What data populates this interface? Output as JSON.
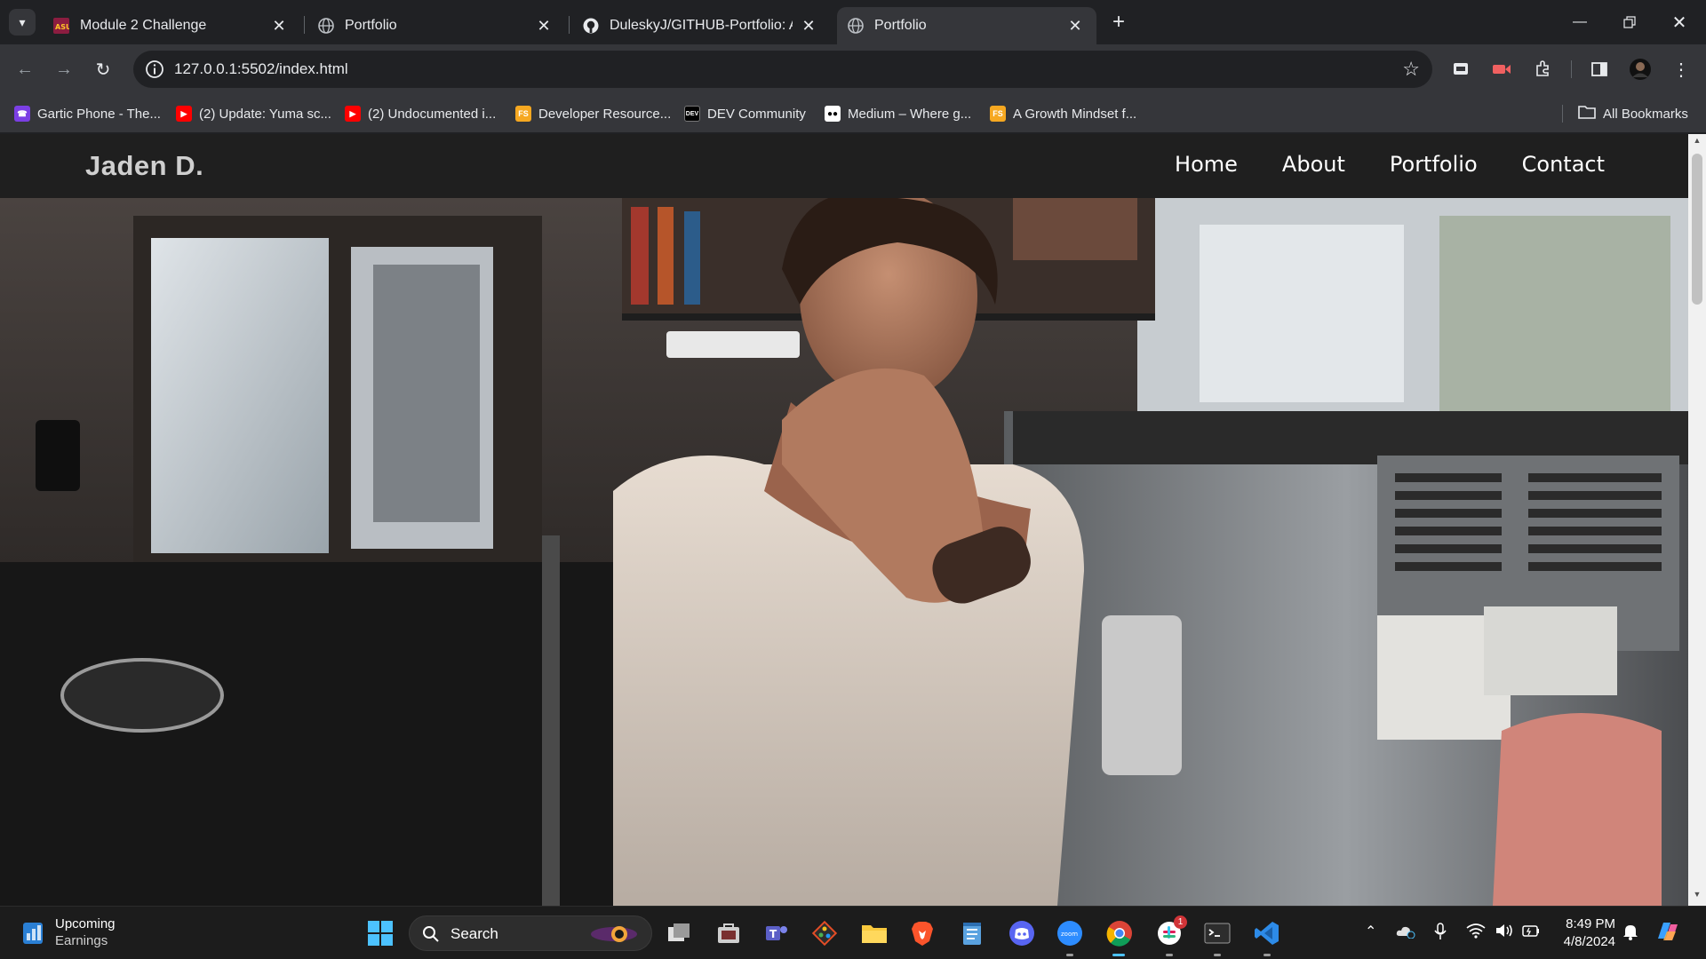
{
  "tabs": [
    {
      "title": "Module 2 Challenge",
      "favicon": "asu-icon",
      "active": false
    },
    {
      "title": "Portfolio",
      "favicon": "globe-icon",
      "active": false
    },
    {
      "title": "DuleskyJ/GITHUB-Portfolio: A w",
      "favicon": "github-icon",
      "active": false
    },
    {
      "title": "Portfolio",
      "favicon": "globe-icon",
      "active": true
    }
  ],
  "address_bar": {
    "url": "127.0.0.1:5502/index.html"
  },
  "bookmarks": [
    {
      "label": "Gartic Phone - The...",
      "icon": "gartic-icon",
      "color": "#7b3fe4"
    },
    {
      "label": "(2) Update: Yuma sc...",
      "icon": "youtube-icon",
      "color": "#ff0000"
    },
    {
      "label": "(2) Undocumented i...",
      "icon": "youtube-icon",
      "color": "#ff0000"
    },
    {
      "label": "Developer Resource...",
      "icon": "fs-icon",
      "color": "#f6a821"
    },
    {
      "label": "DEV Community",
      "icon": "dev-icon",
      "color": "#000000"
    },
    {
      "label": "Medium – Where g...",
      "icon": "medium-icon",
      "color": "#000000"
    },
    {
      "label": "A Growth Mindset f...",
      "icon": "fs-icon",
      "color": "#f6a821"
    }
  ],
  "bookmarks_folder": {
    "label": "All Bookmarks"
  },
  "site": {
    "brand": "Jaden D.",
    "nav": [
      "Home",
      "About",
      "Portfolio",
      "Contact"
    ]
  },
  "taskbar": {
    "widget_title": "Upcoming",
    "widget_subtitle": "Earnings",
    "search_label": "Search",
    "time": "8:49 PM",
    "date": "4/8/2024",
    "teams_badge": "1"
  },
  "colors": {
    "chrome_dark": "#202124",
    "chrome_toolbar": "#35363a",
    "site_nav": "#1f1f1f",
    "taskbar": "#1c1c1c"
  }
}
